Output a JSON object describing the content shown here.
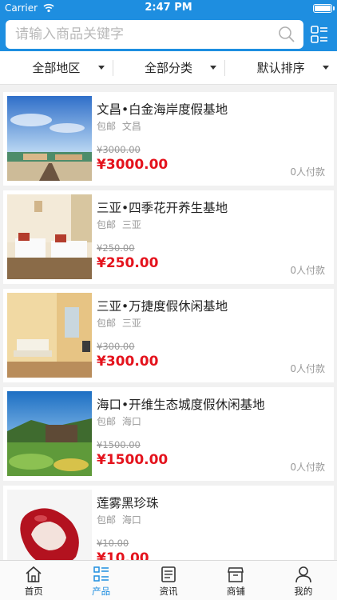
{
  "status": {
    "carrier": "Carrier",
    "time": "2:47 PM"
  },
  "search": {
    "placeholder": "请输入商品关键字"
  },
  "filters": [
    {
      "label": "全部地区"
    },
    {
      "label": "全部分类"
    },
    {
      "label": "默认排序"
    }
  ],
  "products": [
    {
      "title": "文昌•白金海岸度假基地",
      "shipping": "包邮",
      "location": "文昌",
      "old_price": "¥3000.00",
      "price": "¥3000.00",
      "paid": "0人付款"
    },
    {
      "title": "三亚•四季花开养生基地",
      "shipping": "包邮",
      "location": "三亚",
      "old_price": "¥250.00",
      "price": "¥250.00",
      "paid": "0人付款"
    },
    {
      "title": "三亚•万捷度假休闲基地",
      "shipping": "包邮",
      "location": "三亚",
      "old_price": "¥300.00",
      "price": "¥300.00",
      "paid": "0人付款"
    },
    {
      "title": "海口•开维生态城度假休闲基地",
      "shipping": "包邮",
      "location": "海口",
      "old_price": "¥1500.00",
      "price": "¥1500.00",
      "paid": "0人付款"
    },
    {
      "title": "莲雾黑珍珠",
      "shipping": "包邮",
      "location": "海口",
      "old_price": "¥10.00",
      "price": "¥10.00",
      "paid": ""
    }
  ],
  "tabs": [
    {
      "label": "首页",
      "icon": "home-icon"
    },
    {
      "label": "产品",
      "icon": "list-icon",
      "active": true
    },
    {
      "label": "资讯",
      "icon": "news-icon"
    },
    {
      "label": "商铺",
      "icon": "store-icon"
    },
    {
      "label": "我的",
      "icon": "user-icon"
    }
  ],
  "colors": {
    "brand": "#1e8ee0",
    "price": "#e4131d"
  }
}
